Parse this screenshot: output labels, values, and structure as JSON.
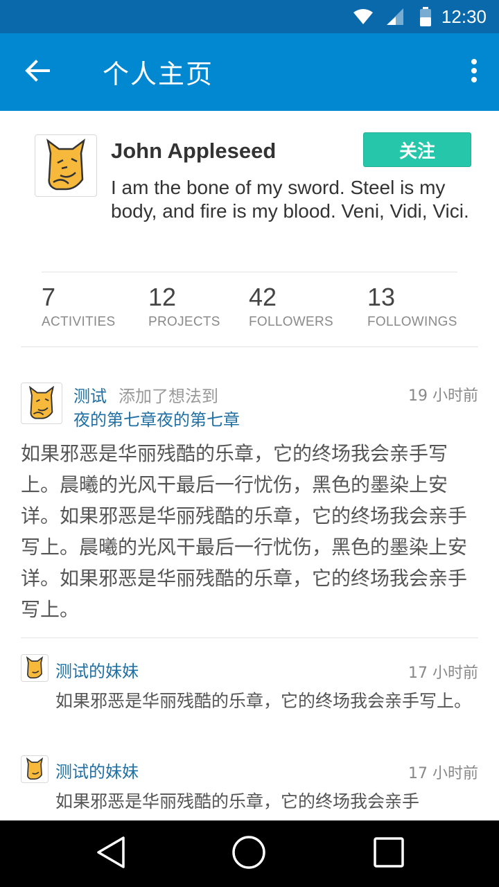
{
  "status_bar": {
    "time": "12:30"
  },
  "app_bar": {
    "title": "个人主页"
  },
  "profile": {
    "name": "John Appleseed",
    "bio": "I am the bone of my sword. Steel is my body, and fire is my blood. Veni, Vidi, Vici.",
    "follow_label": "关注",
    "stats": [
      {
        "value": "7",
        "label": "ACTIVITIES"
      },
      {
        "value": "12",
        "label": "PROJECTS"
      },
      {
        "value": "42",
        "label": "FOLLOWERS"
      },
      {
        "value": "13",
        "label": "FOLLOWINGS"
      }
    ]
  },
  "activity": {
    "user": "测试",
    "action": "添加了想法到",
    "target": "夜的第七章夜的第七章",
    "time": "19 小时前",
    "content": "如果邪恶是华丽残酷的乐章，它的终场我会亲手写上。晨曦的光风干最后一行忧伤，黑色的墨染上安详。如果邪恶是华丽残酷的乐章，它的终场我会亲手写上。晨曦的光风干最后一行忧伤，黑色的墨染上安详。如果邪恶是华丽残酷的乐章，它的终场我会亲手写上。"
  },
  "comments": [
    {
      "user": "测试的妹妹",
      "time": "17 小时前",
      "text": "如果邪恶是华丽残酷的乐章，它的终场我会亲手写上。"
    },
    {
      "user": "测试的妹妹",
      "time": "17 小时前",
      "text": "如果邪恶是华丽残酷的乐章，它的终场我会亲手"
    }
  ],
  "colors": {
    "status_bar": "#0a69ab",
    "app_bar": "#0288d1",
    "follow_button": "#26c6aa",
    "link": "#1f6fa3"
  },
  "icons": [
    "wifi-icon",
    "signal-icon",
    "battery-icon",
    "back-arrow-icon",
    "more-vert-icon",
    "nav-back-icon",
    "nav-home-icon",
    "nav-recents-icon"
  ]
}
